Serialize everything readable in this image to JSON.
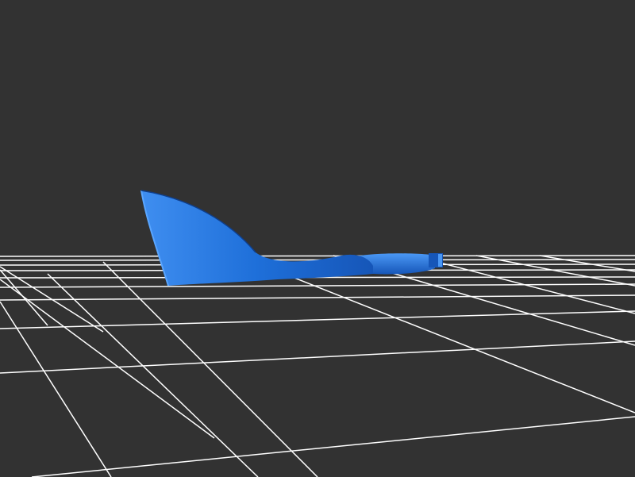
{
  "viewport": {
    "background_color": "#323232",
    "grid_color": "#ffffff",
    "model_color": "#1e6fd9",
    "model_highlight_color": "#3f8ef0",
    "model_shadow_color": "#0f4aa3"
  },
  "scene": {
    "ground_grid": "visible",
    "model_shape": "fin-hook"
  }
}
